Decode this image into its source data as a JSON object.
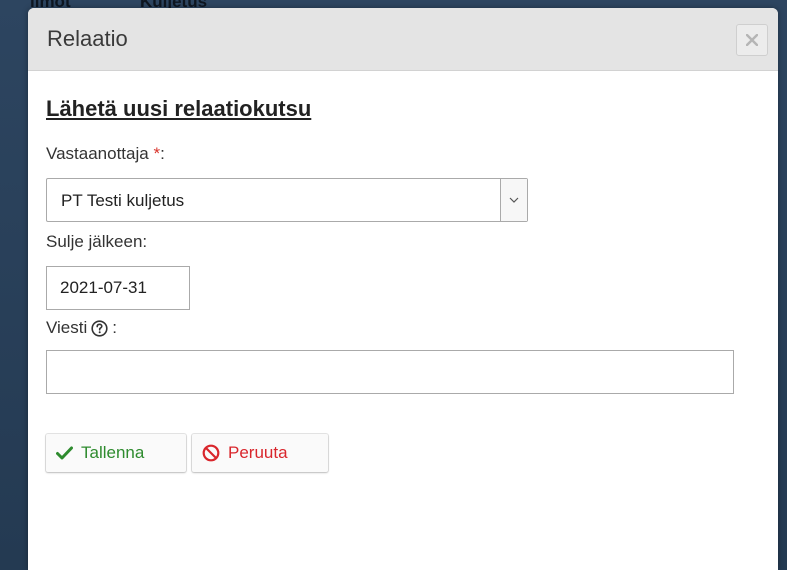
{
  "background": {
    "fragments": [
      "ilmot",
      "Kuljetus"
    ]
  },
  "dialog": {
    "title": "Relaatio",
    "close_label": "×"
  },
  "form": {
    "heading": "Lähetä uusi relaatiokutsu",
    "recipient": {
      "label": "Vastaanottaja",
      "required_mark": "*",
      "suffix": ":",
      "value": "PT Testi kuljetus"
    },
    "close_after": {
      "label": "Sulje jälkeen:",
      "value": "2021-07-31"
    },
    "message": {
      "label": "Viesti",
      "suffix": ":",
      "value": ""
    }
  },
  "buttons": {
    "save": "Tallenna",
    "cancel": "Peruuta"
  },
  "colors": {
    "save": "#2e8b2e",
    "cancel": "#d9262c",
    "required": "#d9332b"
  }
}
